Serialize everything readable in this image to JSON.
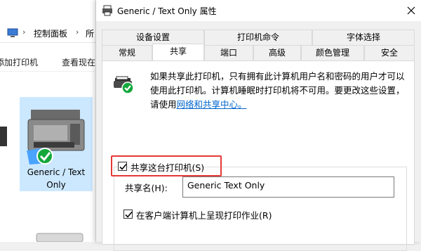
{
  "explorer": {
    "breadcrumb": [
      "控制面板",
      "所"
    ],
    "commands": [
      "添加打印机",
      "查看现在"
    ],
    "device_label": "Generic / Text Only"
  },
  "dialog": {
    "title": "Generic / Text Only 属性",
    "tabs_row1": [
      "设备设置",
      "打印机命令",
      "字体选择"
    ],
    "tabs_row2": [
      "常规",
      "共享",
      "端口",
      "高级",
      "颜色管理",
      "安全"
    ],
    "active_tab": "共享",
    "description": "如果共享此打印机，只有拥有此计算机用户名和密码的用户才可以使用此打印机。计算机睡眠时打印机将不可用。要更改这些设置，请使用",
    "link_text": "网络和共享中心。",
    "share_checkbox": {
      "label": "共享这台打印机(S)",
      "checked": true
    },
    "share_name": {
      "label": "共享名(H):",
      "value": "Generic  Text Only"
    },
    "render_checkbox": {
      "label": "在客户端计算机上呈现打印作业(R)",
      "checked": true
    }
  },
  "colors": {
    "accent": "#0066cc",
    "highlight": "#e53935",
    "selection": "#cce8ff",
    "check_green": "#14a83b"
  }
}
